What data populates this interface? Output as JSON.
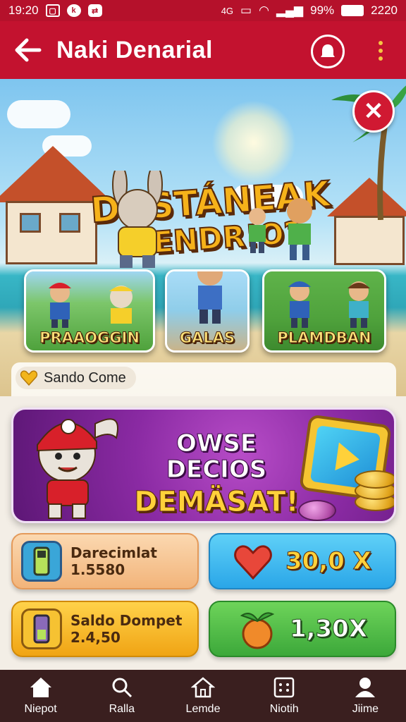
{
  "status_bar": {
    "time": "19:20",
    "network_text": "4G",
    "battery_percent": "99%",
    "extra_number": "2220"
  },
  "header": {
    "title": "Naki Denarial",
    "back_icon": "arrow-left-icon",
    "notification_icon": "bell-icon",
    "menu_icon": "kebab-menu-icon"
  },
  "hero": {
    "title_line1": "DUSTÁNEAK",
    "title_line2": "IDENDR!O?",
    "close_icon": "close-icon",
    "cards": [
      {
        "label": "PRAAOGGIN"
      },
      {
        "label": "GALAS"
      },
      {
        "label": "PLAMDBAN"
      }
    ],
    "coin_label": "Sando Come"
  },
  "promo": {
    "line1": "OWSE DECIOS",
    "line2": "DEMÄSAT!"
  },
  "tiles": [
    {
      "title": "Darecimlat",
      "value": "1.5580",
      "color": "#f7c79a"
    },
    {
      "value": "30,0 X",
      "color": "#3db8ef"
    },
    {
      "title": "Saldo Dompet",
      "value": "2.4,50",
      "color": "#f7b21e"
    },
    {
      "value": "1,30X",
      "color": "#4cc04a"
    }
  ],
  "bottom_nav": [
    {
      "label": "Niepot",
      "icon": "home-icon"
    },
    {
      "label": "Ralla",
      "icon": "search-icon"
    },
    {
      "label": "Lemde",
      "icon": "house-outline-icon"
    },
    {
      "label": "Niotih",
      "icon": "dice-icon"
    },
    {
      "label": "Jiime",
      "icon": "user-icon"
    }
  ],
  "colors": {
    "header_red": "#c3122f",
    "promo_purple": "#8a2aa3",
    "nav_bg": "#3a1f1f"
  }
}
